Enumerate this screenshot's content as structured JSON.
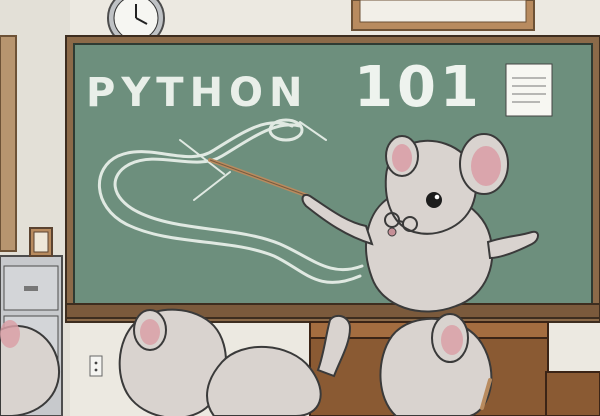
{
  "board": {
    "title_left": "PYTHON",
    "title_right": "101"
  },
  "colors": {
    "wall": "#ece9e1",
    "board": "#6d8f7d",
    "board_frame": "#8b6a49",
    "chalk": "#e7eee8",
    "mouse_fur": "#d9d3cf",
    "mouse_ear_inner": "#d9a0a7",
    "desk": "#8a5a33",
    "clock_face": "#f6f6f2"
  },
  "icons": {
    "clock": "wall-clock-icon",
    "pointer": "pointer-stick-icon",
    "outlet": "outlet-icon"
  }
}
